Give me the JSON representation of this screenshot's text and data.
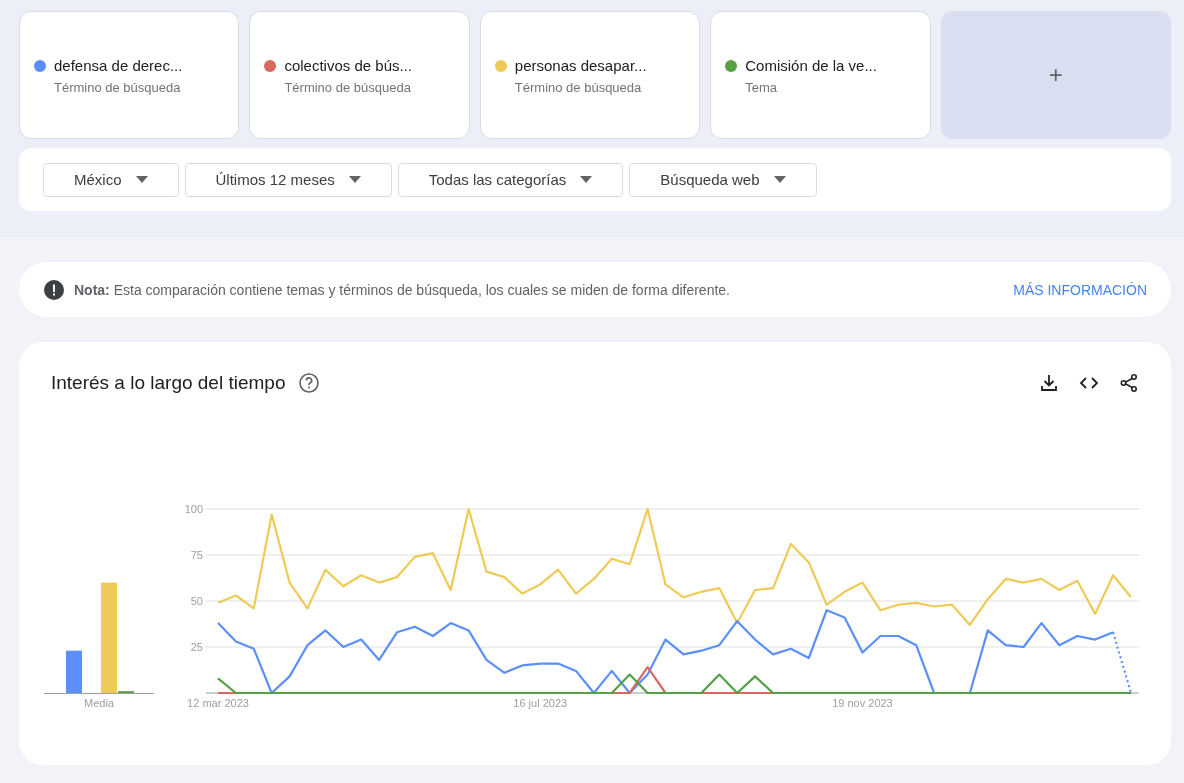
{
  "terms": [
    {
      "label": "defensa de derec...",
      "type": "Término de búsqueda",
      "color": "#5b8ff9"
    },
    {
      "label": "colectivos de bús...",
      "type": "Término de búsqueda",
      "color": "#d9685f"
    },
    {
      "label": "personas desapar...",
      "type": "Término de búsqueda",
      "color": "#edcb56"
    },
    {
      "label": "Comisión de la ve...",
      "type": "Tema",
      "color": "#55a045"
    }
  ],
  "add_button": {
    "label": "+"
  },
  "filters": [
    "México",
    "Últimos 12 meses",
    "Todas las categorías",
    "Búsqueda web"
  ],
  "note": {
    "text": "**Nota:** Esta comparación contiene temas y términos de búsqueda, los cuales se miden de forma diferente.",
    "link": "MÁS INFORMACIÓN"
  },
  "interest": {
    "title": "Interés a lo largo del tiempo",
    "average_chart": {
      "chart_data": {
        "type": "bar",
        "categories": [
          "Media"
        ],
        "ylim": [
          0,
          100
        ],
        "series": [
          {
            "color": "#5b8ff9",
            "values": [
              23
            ]
          },
          {
            "color": "#edcb56",
            "values": [
              60
            ]
          },
          {
            "color": "#55a045",
            "values": [
              1
            ]
          }
        ]
      }
    },
    "time_chart": {
      "chart_data": {
        "type": "line",
        "categories": [
          "12 mar 2023",
          null,
          null,
          null,
          null,
          null,
          null,
          null,
          null,
          null,
          null,
          null,
          null,
          null,
          null,
          null,
          null,
          null,
          "16 jul 2023",
          null,
          null,
          null,
          null,
          null,
          null,
          null,
          null,
          null,
          null,
          null,
          null,
          null,
          null,
          null,
          null,
          null,
          "19 nov 2023",
          null,
          null,
          null,
          null,
          null,
          null,
          null,
          null,
          null,
          null,
          null,
          null,
          null,
          null,
          null
        ],
        "ylim": [
          0,
          100
        ],
        "yticks": [
          25,
          50,
          75,
          100
        ],
        "grid": true,
        "series": [
          {
            "color": "#edcb56",
            "values": [
              49,
              53,
              46,
              97,
              60,
              46,
              67,
              58,
              64,
              60,
              63,
              74,
              76,
              56,
              100,
              66,
              63,
              54,
              59,
              67,
              54,
              62,
              73,
              70,
              100,
              59,
              52,
              55,
              57,
              38,
              56,
              57,
              81,
              71,
              48,
              55,
              60,
              45,
              48,
              49,
              47,
              48,
              37,
              51,
              62,
              60,
              62,
              56,
              61,
              43,
              64,
              52
            ]
          },
          {
            "color": "#5b8ff9",
            "values": [
              38,
              28,
              24,
              0,
              9,
              26,
              34,
              25,
              29,
              18,
              33,
              36,
              31,
              38,
              34,
              18,
              11,
              15,
              16,
              16,
              12,
              0,
              12,
              0,
              10,
              29,
              21,
              23,
              26,
              39,
              29,
              21,
              24,
              19,
              45,
              41,
              22,
              31,
              31,
              26,
              0,
              0,
              0,
              34,
              26,
              25,
              38,
              26,
              31,
              29,
              33,
              null
            ]
          },
          {
            "color": "#5b8ff9",
            "line_style": "dotted",
            "values": [
              null,
              null,
              null,
              null,
              null,
              null,
              null,
              null,
              null,
              null,
              null,
              null,
              null,
              null,
              null,
              null,
              null,
              null,
              null,
              null,
              null,
              null,
              null,
              null,
              null,
              null,
              null,
              null,
              null,
              null,
              null,
              null,
              null,
              null,
              null,
              null,
              null,
              null,
              null,
              null,
              null,
              null,
              null,
              null,
              null,
              null,
              null,
              null,
              null,
              null,
              33,
              0
            ]
          },
          {
            "color": "#d9685f",
            "values": [
              0,
              0,
              null,
              null,
              null,
              null,
              null,
              null,
              null,
              null,
              null,
              null,
              null,
              null,
              null,
              null,
              null,
              null,
              null,
              null,
              null,
              null,
              0,
              0,
              14,
              0,
              null,
              0,
              0,
              0,
              0,
              0,
              null,
              null,
              null,
              null,
              null,
              null,
              null,
              null,
              null,
              null,
              null,
              null,
              null,
              null,
              null,
              null,
              null,
              null,
              null,
              null
            ]
          },
          {
            "color": "#55a045",
            "values": [
              8,
              0,
              0,
              0,
              0,
              0,
              0,
              0,
              0,
              0,
              0,
              0,
              0,
              0,
              0,
              0,
              0,
              0,
              0,
              0,
              0,
              0,
              0,
              10,
              0,
              0,
              0,
              0,
              10,
              0,
              9,
              0,
              0,
              0,
              0,
              0,
              0,
              0,
              0,
              0,
              0,
              0,
              0,
              0,
              0,
              0,
              0,
              0,
              0,
              0,
              0,
              0
            ]
          }
        ]
      }
    }
  }
}
